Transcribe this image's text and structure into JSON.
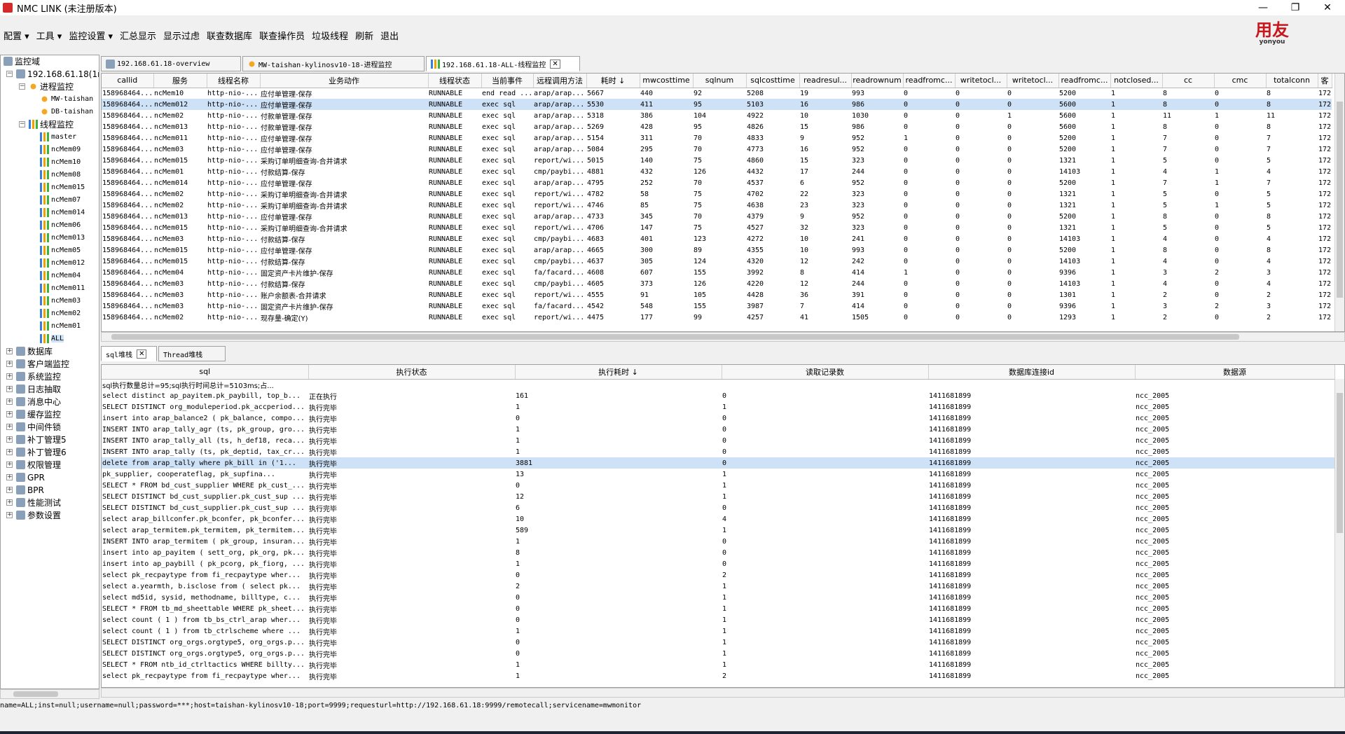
{
  "window": {
    "title": "NMC LINK (未注册版本)",
    "minimize": "—",
    "maximize": "❐",
    "close": "✕"
  },
  "menu": [
    "配置 ▾",
    "工具 ▾",
    "监控设置 ▾",
    "汇总显示",
    "显示过虑",
    "联查数据库",
    "联查操作员",
    "垃圾线程",
    "刷新",
    "退出"
  ],
  "logo": {
    "text": "用友",
    "sub": "yonyou"
  },
  "tree": [
    {
      "label": "监控域",
      "level": 0,
      "exp": "",
      "icon": "box"
    },
    {
      "label": "192.168.61.18(1n",
      "level": 1,
      "exp": "−",
      "icon": "box"
    },
    {
      "label": "进程监控",
      "level": 2,
      "exp": "−",
      "icon": "sun"
    },
    {
      "label": "MW-taishan",
      "level": 3,
      "exp": "",
      "icon": "sun"
    },
    {
      "label": "DB-taishan",
      "level": 3,
      "exp": "",
      "icon": "sun"
    },
    {
      "label": "线程监控",
      "level": 2,
      "exp": "−",
      "icon": "bar"
    },
    {
      "label": "master",
      "level": 3,
      "exp": "",
      "icon": "bar"
    },
    {
      "label": "ncMem09",
      "level": 3,
      "exp": "",
      "icon": "bar"
    },
    {
      "label": "ncMem10",
      "level": 3,
      "exp": "",
      "icon": "bar"
    },
    {
      "label": "ncMem08",
      "level": 3,
      "exp": "",
      "icon": "bar"
    },
    {
      "label": "ncMem015",
      "level": 3,
      "exp": "",
      "icon": "bar"
    },
    {
      "label": "ncMem07",
      "level": 3,
      "exp": "",
      "icon": "bar"
    },
    {
      "label": "ncMem014",
      "level": 3,
      "exp": "",
      "icon": "bar"
    },
    {
      "label": "ncMem06",
      "level": 3,
      "exp": "",
      "icon": "bar"
    },
    {
      "label": "ncMem013",
      "level": 3,
      "exp": "",
      "icon": "bar"
    },
    {
      "label": "ncMem05",
      "level": 3,
      "exp": "",
      "icon": "bar"
    },
    {
      "label": "ncMem012",
      "level": 3,
      "exp": "",
      "icon": "bar"
    },
    {
      "label": "ncMem04",
      "level": 3,
      "exp": "",
      "icon": "bar"
    },
    {
      "label": "ncMem011",
      "level": 3,
      "exp": "",
      "icon": "bar"
    },
    {
      "label": "ncMem03",
      "level": 3,
      "exp": "",
      "icon": "bar"
    },
    {
      "label": "ncMem02",
      "level": 3,
      "exp": "",
      "icon": "bar"
    },
    {
      "label": "ncMem01",
      "level": 3,
      "exp": "",
      "icon": "bar"
    },
    {
      "label": "ALL",
      "level": 3,
      "exp": "",
      "icon": "bar"
    },
    {
      "label": "数据库",
      "level": 1,
      "exp": "+",
      "icon": "box"
    },
    {
      "label": "客户端监控",
      "level": 1,
      "exp": "+",
      "icon": "box"
    },
    {
      "label": "系统监控",
      "level": 1,
      "exp": "+",
      "icon": "box"
    },
    {
      "label": "日志抽取",
      "level": 1,
      "exp": "+",
      "icon": "box"
    },
    {
      "label": "消息中心",
      "level": 1,
      "exp": "+",
      "icon": "box"
    },
    {
      "label": "缓存监控",
      "level": 1,
      "exp": "+",
      "icon": "box"
    },
    {
      "label": "中间件锁",
      "level": 1,
      "exp": "+",
      "icon": "box"
    },
    {
      "label": "补丁管理5",
      "level": 1,
      "exp": "+",
      "icon": "box"
    },
    {
      "label": "补丁管理6",
      "level": 1,
      "exp": "+",
      "icon": "box"
    },
    {
      "label": "权限管理",
      "level": 1,
      "exp": "+",
      "icon": "box"
    },
    {
      "label": "GPR",
      "level": 1,
      "exp": "+",
      "icon": "box"
    },
    {
      "label": "BPR",
      "level": 1,
      "exp": "+",
      "icon": "box"
    },
    {
      "label": "性能测试",
      "level": 1,
      "exp": "+",
      "icon": "box"
    },
    {
      "label": "参数设置",
      "level": 1,
      "exp": "+",
      "icon": "box"
    }
  ],
  "topTabs": [
    {
      "label": "192.168.61.18-overview",
      "active": false
    },
    {
      "label": "MW-taishan-kylinosv10-18-进程监控",
      "active": false
    },
    {
      "label": "192.168.61.18-ALL-线程监控",
      "active": true,
      "close": "✕"
    }
  ],
  "threads": {
    "columns": [
      "callid",
      "服务",
      "线程名称",
      "业务动作",
      "线程状态",
      "当前事件",
      "远程调用方法",
      "耗时 ↓",
      "mwcosttime",
      "sqlnum",
      "sqlcosttime",
      "readresul...",
      "readrownum",
      "readfromc...",
      "writetocl...",
      "writetocl...",
      "readfromc...",
      "notclosed...",
      "cc",
      "cmc",
      "totalconn",
      "客"
    ],
    "rows": [
      [
        "158968464...",
        "ncMem10",
        "http-nio-...",
        "应付单管理-保存",
        "RUNNABLE",
        "end read ...",
        "arap/arap...",
        "5667",
        "440",
        "92",
        "5208",
        "19",
        "993",
        "0",
        "0",
        "0",
        "5200",
        "1",
        "8",
        "0",
        "8",
        "172"
      ],
      [
        "158968464...",
        "ncMem012",
        "http-nio-...",
        "应付单管理-保存",
        "RUNNABLE",
        "exec sql",
        "arap/arap...",
        "5530",
        "411",
        "95",
        "5103",
        "16",
        "986",
        "0",
        "0",
        "0",
        "5600",
        "1",
        "8",
        "0",
        "8",
        "172"
      ],
      [
        "158968464...",
        "ncMem02",
        "http-nio-...",
        "付款单管理-保存",
        "RUNNABLE",
        "exec sql",
        "arap/arap...",
        "5318",
        "386",
        "104",
        "4922",
        "10",
        "1030",
        "0",
        "0",
        "1",
        "5600",
        "1",
        "11",
        "1",
        "11",
        "172"
      ],
      [
        "158968464...",
        "ncMem013",
        "http-nio-...",
        "付款单管理-保存",
        "RUNNABLE",
        "exec sql",
        "arap/arap...",
        "5269",
        "428",
        "95",
        "4826",
        "15",
        "986",
        "0",
        "0",
        "0",
        "5600",
        "1",
        "8",
        "0",
        "8",
        "172"
      ],
      [
        "158968464...",
        "ncMem011",
        "http-nio-...",
        "应付单管理-保存",
        "RUNNABLE",
        "exec sql",
        "arap/arap...",
        "5154",
        "311",
        "70",
        "4833",
        "9",
        "952",
        "1",
        "0",
        "0",
        "5200",
        "1",
        "7",
        "0",
        "7",
        "172"
      ],
      [
        "158968464...",
        "ncMem03",
        "http-nio-...",
        "应付单管理-保存",
        "RUNNABLE",
        "exec sql",
        "arap/arap...",
        "5084",
        "295",
        "70",
        "4773",
        "16",
        "952",
        "0",
        "0",
        "0",
        "5200",
        "1",
        "7",
        "0",
        "7",
        "172"
      ],
      [
        "158968464...",
        "ncMem015",
        "http-nio-...",
        "采购订单明细查询-合并请求",
        "RUNNABLE",
        "exec sql",
        "report/wi...",
        "5015",
        "140",
        "75",
        "4860",
        "15",
        "323",
        "0",
        "0",
        "0",
        "1321",
        "1",
        "5",
        "0",
        "5",
        "172"
      ],
      [
        "158968464...",
        "ncMem01",
        "http-nio-...",
        "付款结算-保存",
        "RUNNABLE",
        "exec sql",
        "cmp/paybi...",
        "4881",
        "432",
        "126",
        "4432",
        "17",
        "244",
        "0",
        "0",
        "0",
        "14103",
        "1",
        "4",
        "1",
        "4",
        "172"
      ],
      [
        "158968464...",
        "ncMem014",
        "http-nio-...",
        "应付单管理-保存",
        "RUNNABLE",
        "exec sql",
        "arap/arap...",
        "4795",
        "252",
        "70",
        "4537",
        "6",
        "952",
        "0",
        "0",
        "0",
        "5200",
        "1",
        "7",
        "1",
        "7",
        "172"
      ],
      [
        "158968464...",
        "ncMem02",
        "http-nio-...",
        "采购订单明细查询-合并请求",
        "RUNNABLE",
        "exec sql",
        "report/wi...",
        "4782",
        "58",
        "75",
        "4702",
        "22",
        "323",
        "0",
        "0",
        "0",
        "1321",
        "1",
        "5",
        "0",
        "5",
        "172"
      ],
      [
        "158968464...",
        "ncMem02",
        "http-nio-...",
        "采购订单明细查询-合并请求",
        "RUNNABLE",
        "exec sql",
        "report/wi...",
        "4746",
        "85",
        "75",
        "4638",
        "23",
        "323",
        "0",
        "0",
        "0",
        "1321",
        "1",
        "5",
        "1",
        "5",
        "172"
      ],
      [
        "158968464...",
        "ncMem013",
        "http-nio-...",
        "应付单管理-保存",
        "RUNNABLE",
        "exec sql",
        "arap/arap...",
        "4733",
        "345",
        "70",
        "4379",
        "9",
        "952",
        "0",
        "0",
        "0",
        "5200",
        "1",
        "8",
        "0",
        "8",
        "172"
      ],
      [
        "158968464...",
        "ncMem015",
        "http-nio-...",
        "采购订单明细查询-合并请求",
        "RUNNABLE",
        "exec sql",
        "report/wi...",
        "4706",
        "147",
        "75",
        "4527",
        "32",
        "323",
        "0",
        "0",
        "0",
        "1321",
        "1",
        "5",
        "0",
        "5",
        "172"
      ],
      [
        "158968464...",
        "ncMem03",
        "http-nio-...",
        "付款结算-保存",
        "RUNNABLE",
        "exec sql",
        "cmp/paybi...",
        "4683",
        "401",
        "123",
        "4272",
        "10",
        "241",
        "0",
        "0",
        "0",
        "14103",
        "1",
        "4",
        "0",
        "4",
        "172"
      ],
      [
        "158968464...",
        "ncMem015",
        "http-nio-...",
        "应付单管理-保存",
        "RUNNABLE",
        "exec sql",
        "arap/arap...",
        "4665",
        "300",
        "89",
        "4355",
        "10",
        "993",
        "0",
        "0",
        "0",
        "5200",
        "1",
        "8",
        "0",
        "8",
        "172"
      ],
      [
        "158968464...",
        "ncMem015",
        "http-nio-...",
        "付款结算-保存",
        "RUNNABLE",
        "exec sql",
        "cmp/paybi...",
        "4637",
        "305",
        "124",
        "4320",
        "12",
        "242",
        "0",
        "0",
        "0",
        "14103",
        "1",
        "4",
        "0",
        "4",
        "172"
      ],
      [
        "158968464...",
        "ncMem04",
        "http-nio-...",
        "固定资产卡片维护-保存",
        "RUNNABLE",
        "exec sql",
        "fa/facard...",
        "4608",
        "607",
        "155",
        "3992",
        "8",
        "414",
        "1",
        "0",
        "0",
        "9396",
        "1",
        "3",
        "2",
        "3",
        "172"
      ],
      [
        "158968464...",
        "ncMem03",
        "http-nio-...",
        "付款结算-保存",
        "RUNNABLE",
        "exec sql",
        "cmp/paybi...",
        "4605",
        "373",
        "126",
        "4220",
        "12",
        "244",
        "0",
        "0",
        "0",
        "14103",
        "1",
        "4",
        "0",
        "4",
        "172"
      ],
      [
        "158968464...",
        "ncMem03",
        "http-nio-...",
        "账户余额表-合并请求",
        "RUNNABLE",
        "exec sql",
        "report/wi...",
        "4555",
        "91",
        "105",
        "4428",
        "36",
        "391",
        "0",
        "0",
        "0",
        "1301",
        "1",
        "2",
        "0",
        "2",
        "172"
      ],
      [
        "158968464...",
        "ncMem03",
        "http-nio-...",
        "固定资产卡片维护-保存",
        "RUNNABLE",
        "exec sql",
        "fa/facard...",
        "4542",
        "548",
        "155",
        "3987",
        "7",
        "414",
        "0",
        "0",
        "0",
        "9396",
        "1",
        "3",
        "2",
        "3",
        "172"
      ],
      [
        "158968464...",
        "ncMem02",
        "http-nio-...",
        "现存量-确定(Y)",
        "RUNNABLE",
        "exec sql",
        "report/wi...",
        "4475",
        "177",
        "99",
        "4257",
        "41",
        "1505",
        "0",
        "0",
        "0",
        "1293",
        "1",
        "2",
        "0",
        "2",
        "172"
      ]
    ],
    "selected": 1
  },
  "bottomTabs": [
    {
      "label": "sql堆栈",
      "active": true,
      "close": "✕"
    },
    {
      "label": "Thread堆栈",
      "active": false
    }
  ],
  "sqlGrid": {
    "columns": [
      "sql",
      "执行状态",
      "执行耗时 ↓",
      "读取记录数",
      "数据库连接id",
      "数据源"
    ],
    "summary": "sql执行数量总计=95;sql执行时间总计=5103ms;占...",
    "rows": [
      [
        " select distinct ap_payitem.pk_paybill, top_b...",
        "正在执行",
        "161",
        "0",
        "1411681899",
        "ncc_2005"
      ],
      [
        "SELECT DISTINCT org_moduleperiod.pk_accperiod...",
        "执行完毕",
        "1",
        "1",
        "1411681899",
        "ncc_2005"
      ],
      [
        "insert into arap_balance2 ( pk_balance, compo...",
        "执行完毕",
        "0",
        "0",
        "1411681899",
        "ncc_2005"
      ],
      [
        "INSERT INTO arap_tally_agr (ts, pk_group, gro...",
        "执行完毕",
        "1",
        "0",
        "1411681899",
        "ncc_2005"
      ],
      [
        "INSERT INTO arap_tally_all (ts, h_def18, reca...",
        "执行完毕",
        "1",
        "0",
        "1411681899",
        "ncc_2005"
      ],
      [
        "INSERT INTO arap_tally (ts, pk_deptid, tax_cr...",
        "执行完毕",
        "1",
        "0",
        "1411681899",
        "ncc_2005"
      ],
      [
        " delete from arap_tally where pk_bill in ('1...",
        "执行完毕",
        "3881",
        "0",
        "1411681899",
        "ncc_2005"
      ],
      [
        " pk_supplier, cooperateflag, pk_supfina...",
        "执行完毕",
        "13",
        "1",
        "1411681899",
        "ncc_2005"
      ],
      [
        "SELECT * FROM bd_cust_supplier WHERE pk_cust_...",
        "执行完毕",
        "0",
        "1",
        "1411681899",
        "ncc_2005"
      ],
      [
        "SELECT DISTINCT bd_cust_supplier.pk_cust_sup ...",
        "执行完毕",
        "12",
        "1",
        "1411681899",
        "ncc_2005"
      ],
      [
        "SELECT DISTINCT bd_cust_supplier.pk_cust_sup ...",
        "执行完毕",
        "6",
        "0",
        "1411681899",
        "ncc_2005"
      ],
      [
        " select arap_billconfer.pk_bconfer, pk_bconfer...",
        "执行完毕",
        "10",
        "4",
        "1411681899",
        "ncc_2005"
      ],
      [
        " select arap_termitem.pk_termitem, pk_termitem...",
        "执行完毕",
        "589",
        "1",
        "1411681899",
        "ncc_2005"
      ],
      [
        "INSERT INTO arap_termitem ( pk_group, insuran...",
        "执行完毕",
        "1",
        "0",
        "1411681899",
        "ncc_2005"
      ],
      [
        "insert into ap_payitem ( sett_org, pk_org, pk...",
        "执行完毕",
        "8",
        "0",
        "1411681899",
        "ncc_2005"
      ],
      [
        "insert into ap_paybill ( pk_pcorg, pk_fiorg, ...",
        "执行完毕",
        "1",
        "0",
        "1411681899",
        "ncc_2005"
      ],
      [
        " select pk_recpaytype from fi_recpaytype wher...",
        "执行完毕",
        "0",
        "2",
        "1411681899",
        "ncc_2005"
      ],
      [
        " select a.yearmth, b.isclose from ( select pk...",
        "执行完毕",
        "2",
        "1",
        "1411681899",
        "ncc_2005"
      ],
      [
        " select md5id, sysid, methodname, billtype, c...",
        "执行完毕",
        "0",
        "1",
        "1411681899",
        "ncc_2005"
      ],
      [
        "SELECT * FROM tb_md_sheettable WHERE pk_sheet...",
        "执行完毕",
        "0",
        "1",
        "1411681899",
        "ncc_2005"
      ],
      [
        " select count ( 1 ) from tb_bs_ctrl_arap wher...",
        "执行完毕",
        "0",
        "1",
        "1411681899",
        "ncc_2005"
      ],
      [
        " select count ( 1 ) from tb_ctrlscheme where ...",
        "执行完毕",
        "1",
        "1",
        "1411681899",
        "ncc_2005"
      ],
      [
        "SELECT DISTINCT org_orgs.orgtype5, org_orgs.p...",
        "执行完毕",
        "0",
        "1",
        "1411681899",
        "ncc_2005"
      ],
      [
        "SELECT DISTINCT org_orgs.orgtype5, org_orgs.p...",
        "执行完毕",
        "0",
        "1",
        "1411681899",
        "ncc_2005"
      ],
      [
        "SELECT * FROM ntb_id_ctrltactics WHERE billty...",
        "执行完毕",
        "1",
        "1",
        "1411681899",
        "ncc_2005"
      ],
      [
        " select pk_recpaytype from fi_recpaytype wher...",
        "执行完毕",
        "1",
        "2",
        "1411681899",
        "ncc_2005"
      ]
    ],
    "selected": 6
  },
  "status": "name=ALL;inst=null;username=null;password=***;host=taishan-kylinosv10-18;port=9999;requesturl=http://192.168.61.18:9999/remotecall;servicename=mwmonitor"
}
